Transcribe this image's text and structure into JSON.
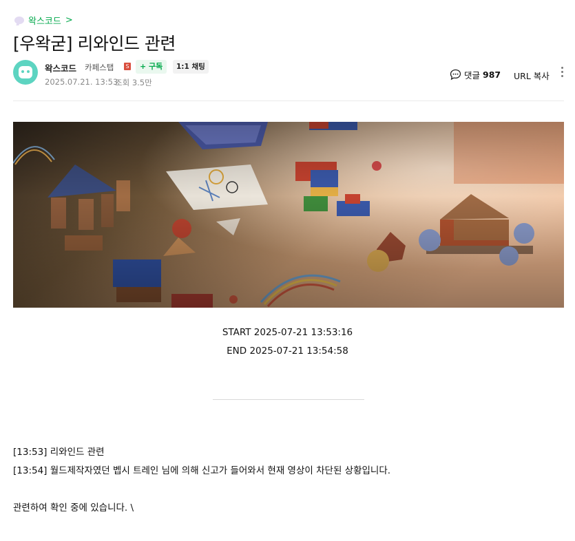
{
  "board": {
    "name": "왁스코드",
    "chevron": ">"
  },
  "post": {
    "title": "[우왁굳] 리와인드 관련"
  },
  "author": {
    "nickname": "왁스코드",
    "grade": "카페스탭",
    "grade_badge": "S",
    "subscribe_label": "+ 구독",
    "chat_label": "1:1 채팅",
    "date": "2025.07.21. 13:53",
    "views": "조회 3.5만"
  },
  "actions": {
    "comment_label": "댓글",
    "comment_count": "987",
    "url_copy_label": "URL 복사"
  },
  "stream": {
    "start": "START 2025-07-21 13:53:16",
    "end": "END 2025-07-21 13:54:58"
  },
  "body_lines": [
    "[13:53] 리와인드 관련",
    "[13:54] 월드제작자였던 벱시 트레인 님에 의해 신고가 들어와서 현재 영상이 차단된 상황입니다.",
    "",
    "관련하여 확인 중에 있습니다. \\"
  ],
  "colors": {
    "accent": "#03a94c",
    "avatar": "#5dd4c1"
  }
}
